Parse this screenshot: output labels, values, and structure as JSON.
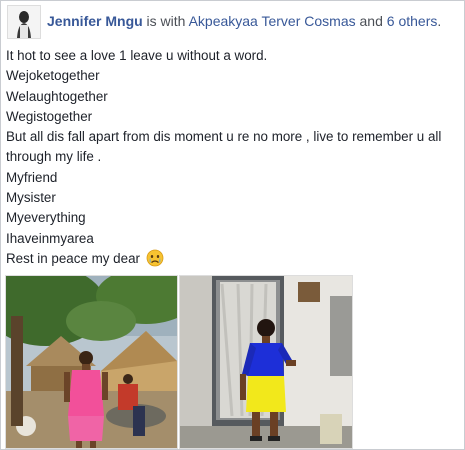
{
  "post": {
    "author": "Jennifer Mngu",
    "with_text": " is with ",
    "tagged": "Akpeakyaa Terver Cosmas",
    "and_text": " and ",
    "others": "6 others",
    "period": "."
  },
  "body_lines": [
    "It hot to see a love 1 leave u without a word.",
    "Wejoketogether",
    "Welaughtogether",
    "Wegistogether",
    "But all dis fall apart from dis moment u re no more , live to remember u all through my life .",
    "Myfriend",
    "Mysister",
    "Myeverything",
    "Ihaveinmyarea",
    "Rest in peace my dear"
  ],
  "icons": {
    "avatar": "profile-photo",
    "emoji": "crying-face-emoji"
  },
  "colors": {
    "link": "#385898",
    "text": "#1d2129",
    "dress_pink": "#f2509a",
    "top_blue": "#1d2fd8",
    "skirt_yellow": "#f2e81b"
  }
}
